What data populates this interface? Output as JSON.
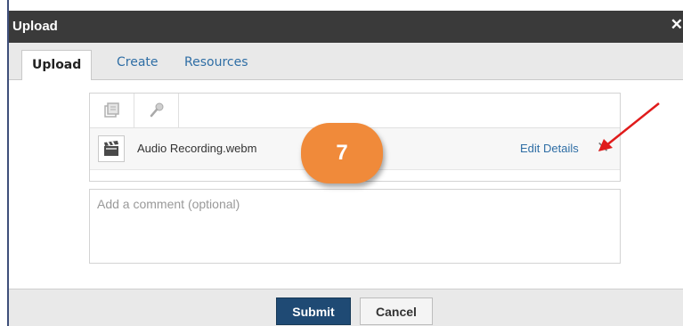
{
  "dialog": {
    "title": "Upload",
    "close_glyph": "✕",
    "tabs": [
      {
        "label": "Upload",
        "active": true
      },
      {
        "label": "Create",
        "active": false
      },
      {
        "label": "Resources",
        "active": false
      }
    ],
    "toolbar": {
      "icons": [
        "gallery-icon",
        "microphone-icon"
      ]
    },
    "file": {
      "icon": "video-file-icon",
      "name": "Audio Recording.webm",
      "edit_label": "Edit Details",
      "remove_glyph": "✕"
    },
    "comment": {
      "placeholder": "Add a comment (optional)",
      "value": ""
    },
    "footer": {
      "submit_label": "Submit",
      "cancel_label": "Cancel"
    }
  },
  "annotation": {
    "step_number": "7",
    "badge_color": "#f08a3a",
    "arrow_color": "#e01b1b"
  },
  "colors": {
    "titlebar": "#3a3a3a",
    "link": "#2f6ea5",
    "primary_button": "#1f4a74"
  }
}
